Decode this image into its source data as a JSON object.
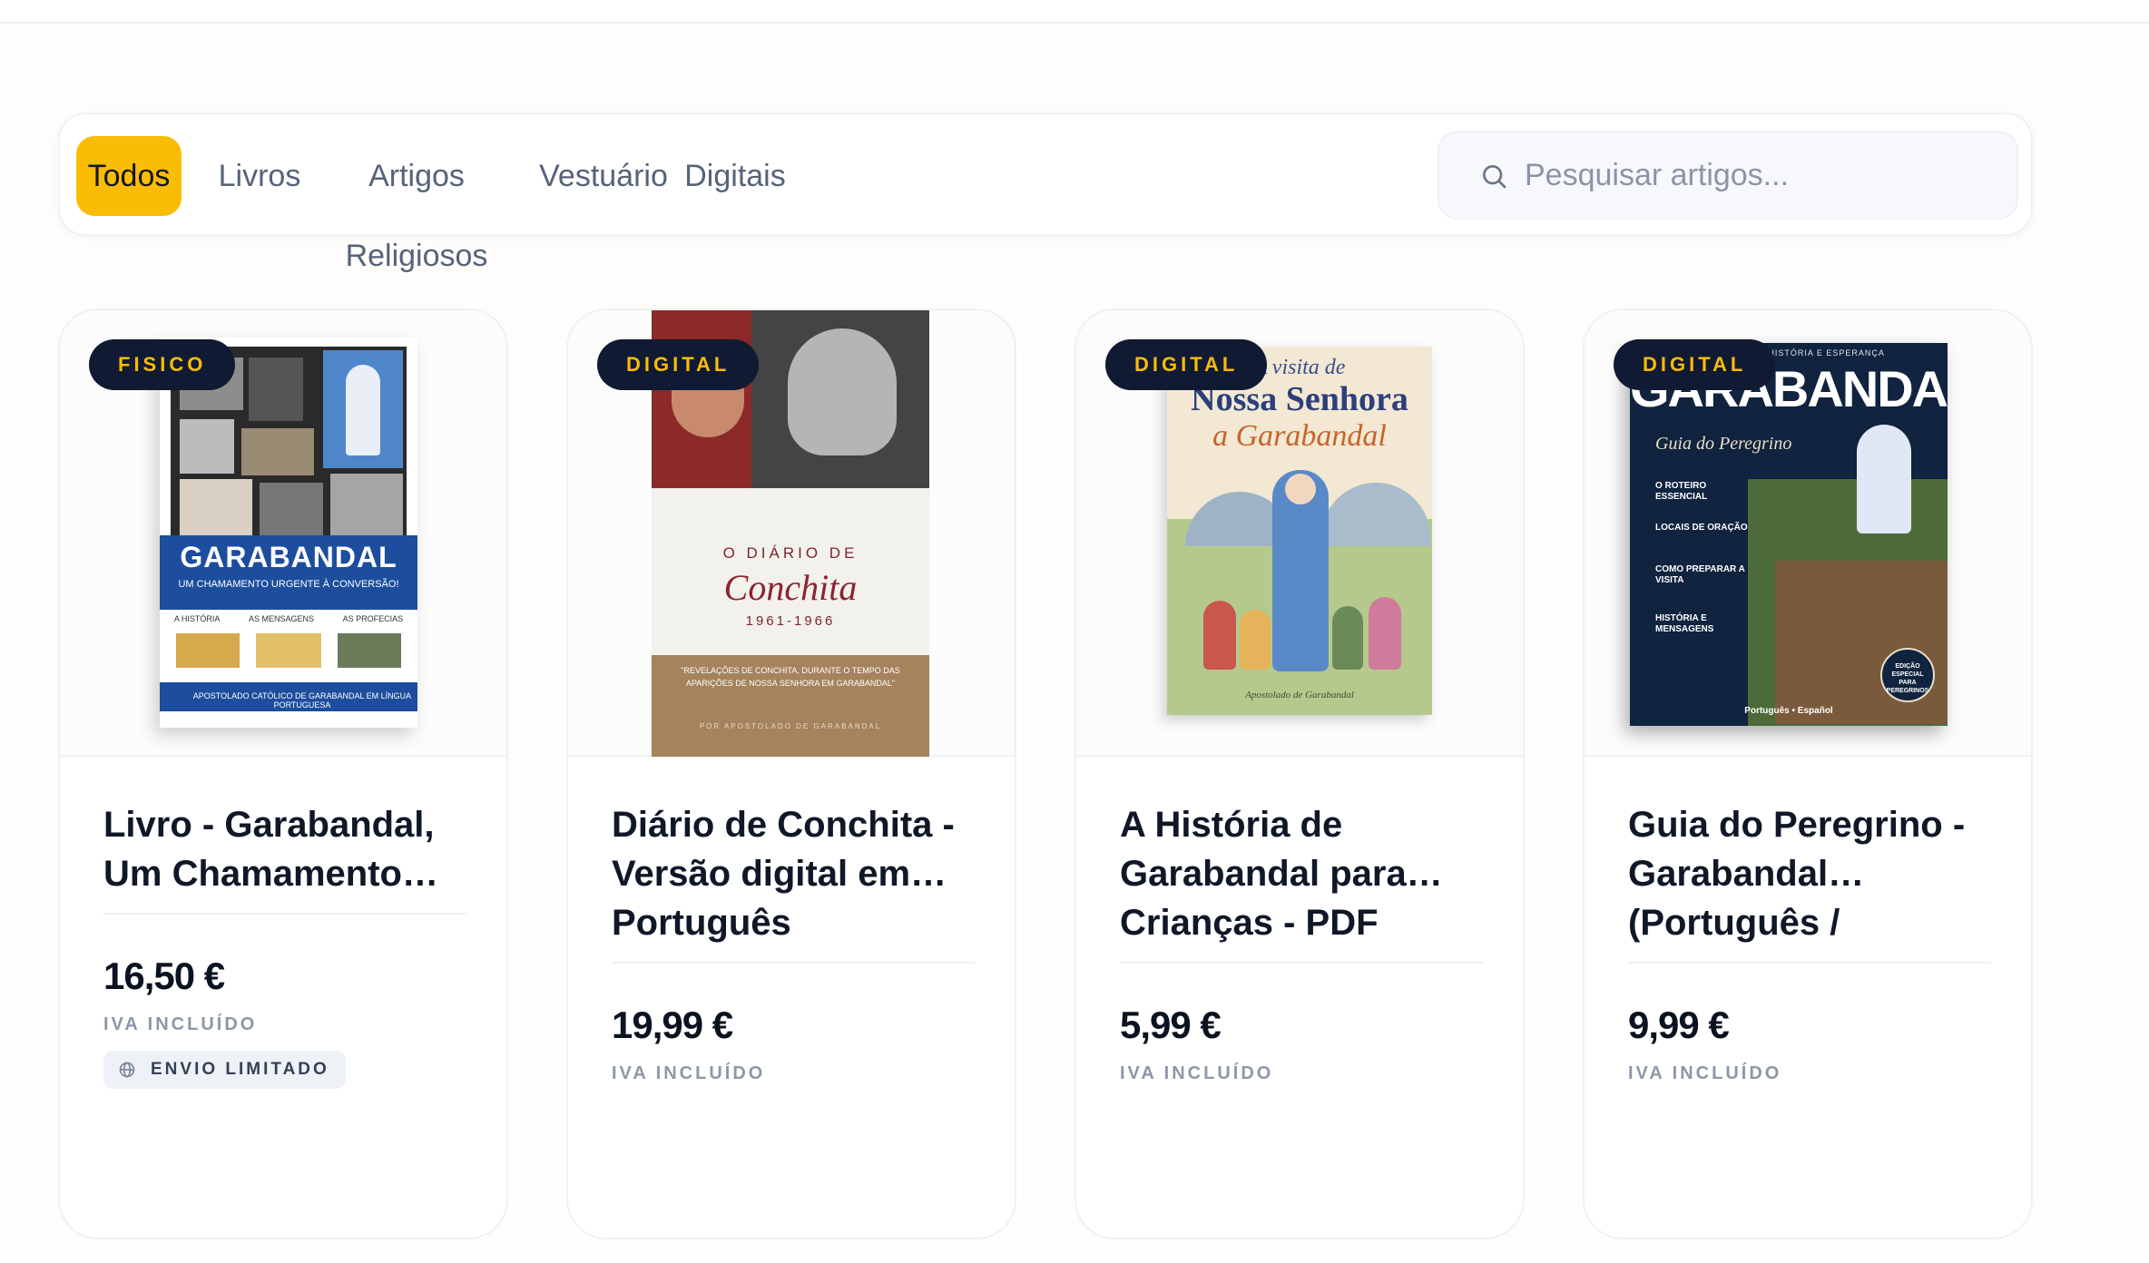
{
  "filters": {
    "tabs": [
      {
        "label": "Todos",
        "active": true
      },
      {
        "label": "Livros",
        "active": false
      },
      {
        "label": "Artigos Religiosos",
        "active": false
      },
      {
        "label": "Vestuário",
        "active": false
      },
      {
        "label": "Digitais",
        "active": false
      }
    ],
    "search": {
      "placeholder": "Pesquisar artigos...",
      "value": "",
      "icon": "search-icon"
    }
  },
  "products": [
    {
      "badge": "FISICO",
      "title": "Livro - Garabandal, Um Chamamento…",
      "price": "16,50 €",
      "tax_note": "IVA INCLUÍDO",
      "shipping_note": "ENVIO LIMITADO",
      "shipping_icon": "globe-icon",
      "cover": {
        "title": "GARABANDAL",
        "subtitle": "UM CHAMAMENTO URGENTE À CONVERSÃO!",
        "sections": [
          "A HISTÓRIA",
          "AS MENSAGENS",
          "AS PROFECIAS"
        ],
        "footer": "APOSTOLADO CATÓLICO DE GARABANDAL EM LÍNGUA PORTUGUESA"
      }
    },
    {
      "badge": "DIGITAL",
      "title": "Diário de Conchita - Versão digital em… Português",
      "price": "19,99 €",
      "tax_note": "IVA INCLUÍDO",
      "cover": {
        "pre": "O DIÁRIO DE",
        "title": "Conchita",
        "years": "1961-1966",
        "quote": "\"REVELAÇÕES DE CONCHITA, DURANTE O TEMPO DAS APARIÇÕES DE NOSSA SENHORA EM GARABANDAL\"",
        "footer": "POR APOSTOLADO DE GARABANDAL"
      }
    },
    {
      "badge": "DIGITAL",
      "title": "A História de Garabandal para… Crianças - PDF",
      "price": "5,99 €",
      "tax_note": "IVA INCLUÍDO",
      "cover": {
        "line1": "A visita de",
        "line2": "Nossa Senhora",
        "line3": "a Garabandal",
        "footer": "Apostolado de Garabandal"
      }
    },
    {
      "badge": "DIGITAL",
      "title": "Guia do Peregrino - Garabandal… (Português /",
      "price": "9,99 €",
      "tax_note": "IVA INCLUÍDO",
      "cover": {
        "top": "ESPECIAL • FÉ, HISTÓRIA E ESPERANÇA",
        "title": "GARABANDAL",
        "subtitle": "Guia do Peregrino",
        "items": [
          "O ROTEIRO ESSENCIAL",
          "LOCAIS DE ORAÇÃO",
          "COMO PREPARAR A VISITA",
          "HISTÓRIA E MENSAGENS"
        ],
        "seal": "EDIÇÃO ESPECIAL PARA PEREGRINOS",
        "languages": "Português • Español"
      }
    }
  ],
  "colors": {
    "accent": "#fbbc05",
    "badge_bg": "#111a33",
    "title": "#101828",
    "muted": "#8c97a8"
  }
}
